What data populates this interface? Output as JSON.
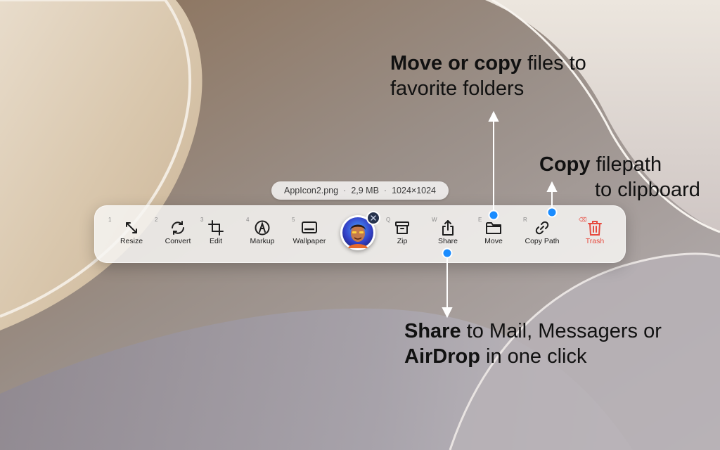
{
  "callouts": {
    "move": {
      "bold": "Move or copy",
      "line1_rest": " files to",
      "line2": "favorite folders"
    },
    "copy": {
      "bold": "Copy",
      "line1_rest": " filepath",
      "line2": "to clipboard"
    },
    "share": {
      "bold1": "Share",
      "line1_rest": " to Mail, Messagers or",
      "bold2": "AirDrop",
      "line2_rest": " in one click"
    }
  },
  "file_info": {
    "name": "AppIcon2.png",
    "size": "2,9 MB",
    "dimensions": "1024×1024",
    "separator": "·"
  },
  "toolbar": {
    "tools": [
      {
        "key": "1",
        "label": "Resize",
        "icon": "resize-icon"
      },
      {
        "key": "2",
        "label": "Convert",
        "icon": "convert-icon"
      },
      {
        "key": "3",
        "label": "Edit",
        "icon": "crop-icon"
      },
      {
        "key": "4",
        "label": "Markup",
        "icon": "markup-pen-icon"
      },
      {
        "key": "5",
        "label": "Wallpaper",
        "icon": "wallpaper-icon"
      },
      {
        "key": "Q",
        "label": "Zip",
        "icon": "archive-box-icon"
      },
      {
        "key": "W",
        "label": "Share",
        "icon": "share-icon"
      },
      {
        "key": "E",
        "label": "Move",
        "icon": "folder-icon"
      },
      {
        "key": "R",
        "label": "Copy Path",
        "icon": "link-icon"
      },
      {
        "key": "⌫",
        "label": "Trash",
        "icon": "trash-icon"
      }
    ],
    "thumbnail": "app-icon-thumbnail",
    "badge_icon": "close-icon"
  },
  "colors": {
    "accent_blue": "#1a8cff",
    "trash_red": "#e74a3f",
    "arrow_white": "#ffffff"
  }
}
